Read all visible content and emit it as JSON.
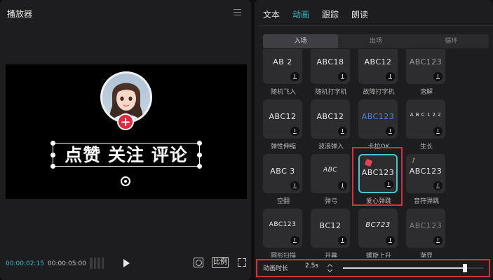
{
  "player": {
    "title": "播放器",
    "overlay_text": "点赞 关注 评论",
    "time_current": "00:00:02:15",
    "time_total": "00:00:05:00",
    "ratio_label": "比例"
  },
  "panel": {
    "tabs": [
      {
        "label": "文本",
        "active": false
      },
      {
        "label": "动画",
        "active": true
      },
      {
        "label": "跟踪",
        "active": false
      },
      {
        "label": "朗读",
        "active": false
      }
    ],
    "segments": [
      {
        "label": "入场",
        "active": true
      },
      {
        "label": "出场",
        "active": false
      },
      {
        "label": "循环",
        "active": false
      }
    ],
    "effects": [
      {
        "label": "随机飞入",
        "preview": "AB  2"
      },
      {
        "label": "随机打字机",
        "preview": "ABC18"
      },
      {
        "label": "故障打字机",
        "preview": "ABC12"
      },
      {
        "label": "溶解",
        "preview": "ABC123"
      },
      {
        "label": "弹性伸缩",
        "preview": "ABC12"
      },
      {
        "label": "波浪弹入",
        "preview": "ABC12"
      },
      {
        "label": "卡拉OK",
        "preview": "ABC123"
      },
      {
        "label": "生长",
        "preview": "A B C 1 2 2"
      },
      {
        "label": "空翻",
        "preview": "ABC 3"
      },
      {
        "label": "弹弓",
        "preview": "ABC"
      },
      {
        "label": "爱心弹跳",
        "preview": "ABC123",
        "selected": true
      },
      {
        "label": "音符弹跳",
        "preview": "ABC123"
      },
      {
        "label": "圆形扫描",
        "preview": "ABC123"
      },
      {
        "label": "开幕",
        "preview": "BC12"
      },
      {
        "label": "螺旋上升",
        "preview": "BC723"
      },
      {
        "label": "渐显",
        "preview": "ABC123"
      }
    ],
    "duration_label": "动画时长",
    "duration_value": "2.5s",
    "duration_fraction": 0.87
  },
  "colors": {
    "accent": "#31b8c4",
    "highlight": "#d0323b",
    "selected_border": "#46c6cf",
    "badge": "#e0283e"
  }
}
